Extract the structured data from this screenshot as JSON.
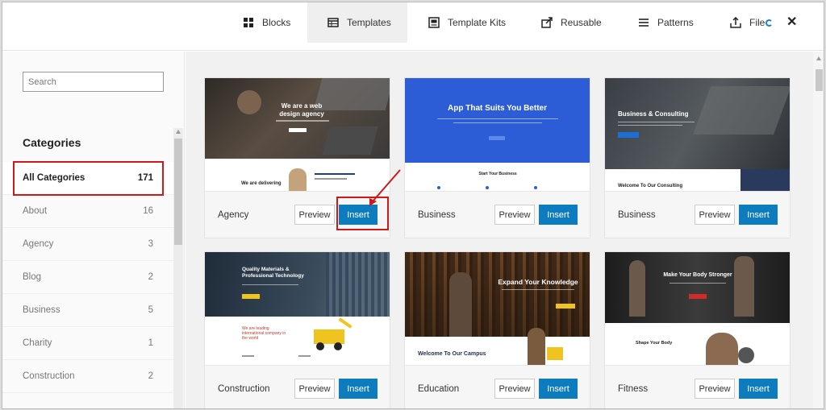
{
  "tabs": [
    {
      "label": "Blocks",
      "icon": "blocks-grid-icon"
    },
    {
      "label": "Templates",
      "icon": "templates-icon"
    },
    {
      "label": "Template Kits",
      "icon": "template-kits-icon"
    },
    {
      "label": "Reusable",
      "icon": "reusable-export-icon"
    },
    {
      "label": "Patterns",
      "icon": "patterns-menu-icon"
    },
    {
      "label": "File",
      "icon": "file-upload-icon"
    }
  ],
  "active_tab": "Templates",
  "search": {
    "placeholder": "Search"
  },
  "sidebar": {
    "title": "Categories",
    "items": [
      {
        "label": "All Categories",
        "count": "171"
      },
      {
        "label": "About",
        "count": "16"
      },
      {
        "label": "Agency",
        "count": "3"
      },
      {
        "label": "Blog",
        "count": "2"
      },
      {
        "label": "Business",
        "count": "5"
      },
      {
        "label": "Charity",
        "count": "1"
      },
      {
        "label": "Construction",
        "count": "2"
      }
    ]
  },
  "buttons": {
    "preview": "Preview",
    "insert": "Insert"
  },
  "templates": [
    {
      "name": "Agency",
      "hero": "We are a web design agency",
      "sub": "We are delivering"
    },
    {
      "name": "Business",
      "hero": "App That Suits You Better",
      "sub": "Start Your Business"
    },
    {
      "name": "Business",
      "hero": "Business & Consulting",
      "sub": "Welcome To Our Consulting"
    },
    {
      "name": "Construction",
      "hero": "Quality Materials & Professional Technology",
      "sub": "We are leading international company in the world"
    },
    {
      "name": "Education",
      "hero": "Expand Your Knowledge",
      "sub": "Welcome To Our Campus"
    },
    {
      "name": "Fitness",
      "hero": "Make Your Body Stronger",
      "sub": "Shape Your Body"
    }
  ],
  "colors": {
    "accent": "#0c7cbf",
    "highlight": "#d01818"
  }
}
